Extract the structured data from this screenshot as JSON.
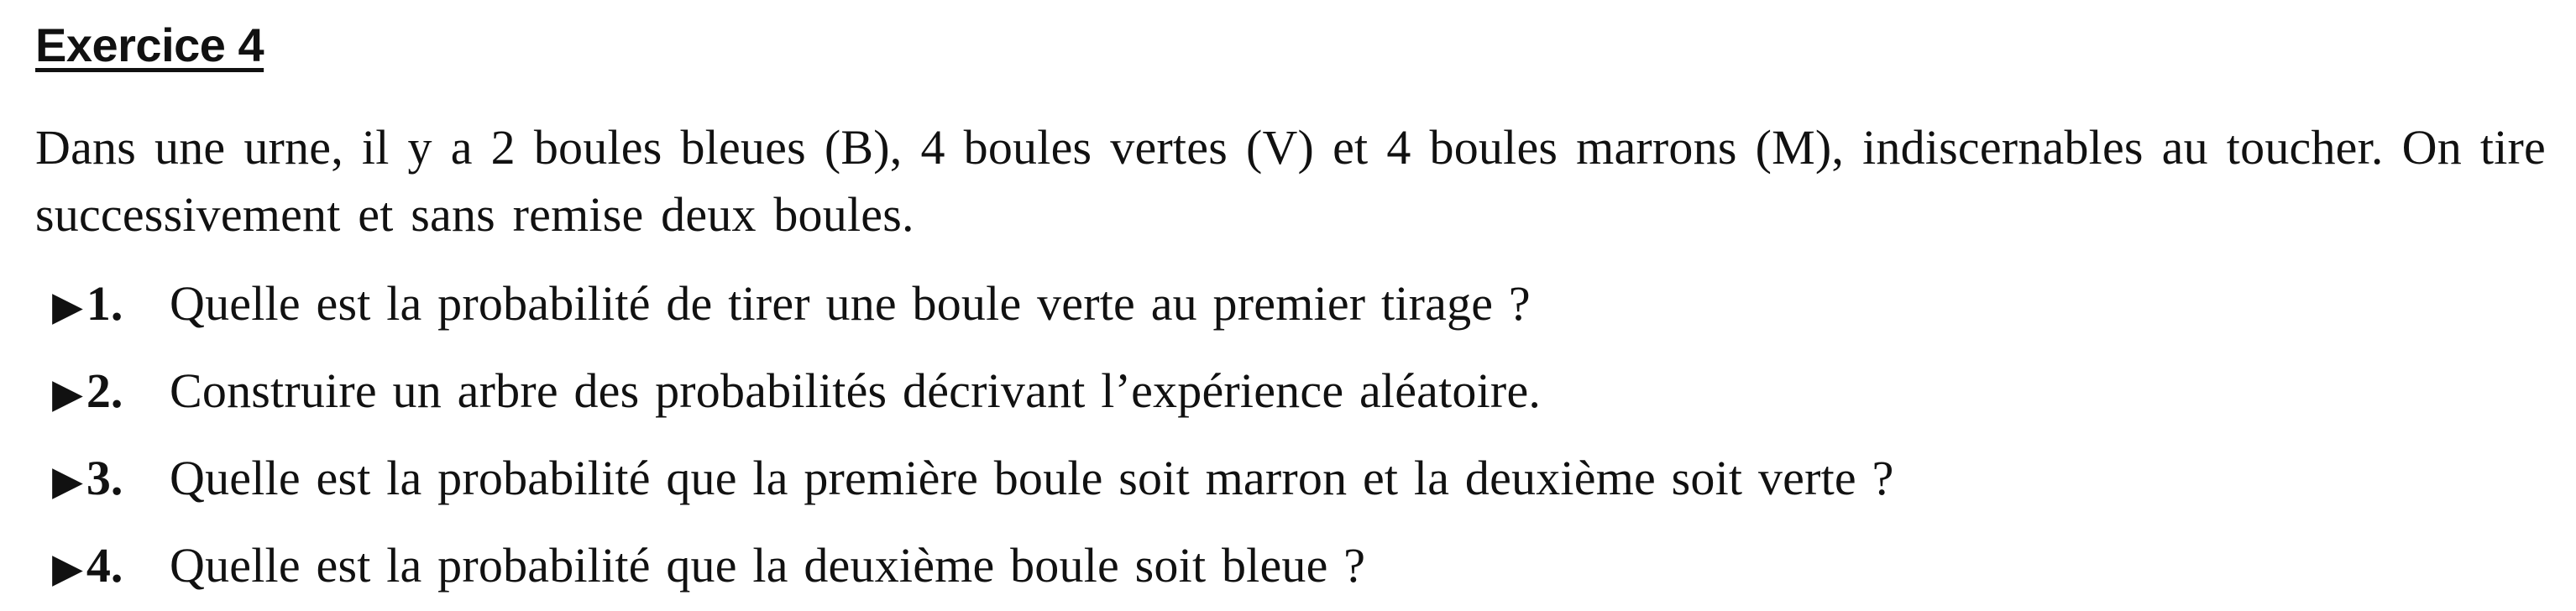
{
  "exercise": {
    "title": "Exercice 4",
    "intro": "Dans une urne, il y a 2 boules bleues (B), 4 boules vertes (V) et 4 boules marrons (M), indiscernables au toucher. On tire successivement et sans remise deux boules.",
    "bullet_icon": "right-pointing-triangle",
    "questions": [
      {
        "number": "1.",
        "text": "Quelle est la probabilité de tirer une boule verte au premier tirage ?"
      },
      {
        "number": "2.",
        "text": "Construire un arbre des probabilités décrivant l’expérience aléatoire."
      },
      {
        "number": "3.",
        "text": "Quelle est la probabilité que la première boule soit marron et la deuxième soit verte ?"
      },
      {
        "number": "4.",
        "text": "Quelle est la probabilité que la deuxième boule soit bleue ?"
      }
    ]
  }
}
